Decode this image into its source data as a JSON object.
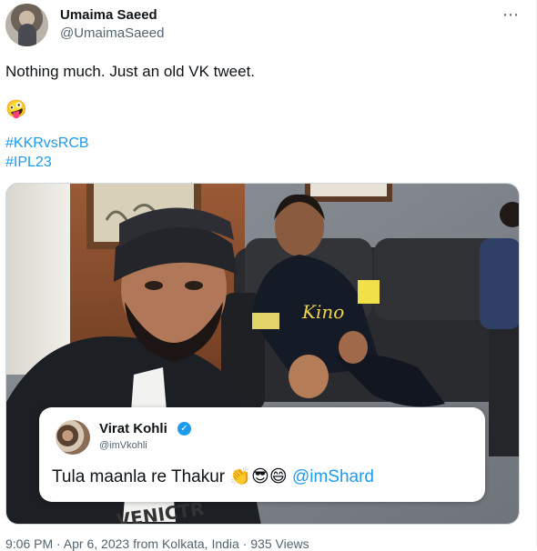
{
  "author": {
    "name": "Umaima Saeed",
    "handle": "@UmaimaSaeed"
  },
  "menu_glyph": "⋯",
  "tweet": {
    "text": "Nothing much. Just an old VK tweet.",
    "emoji": "🤪",
    "hashtags": [
      "#KKRvsRCB",
      "#IPL23"
    ]
  },
  "embedded": {
    "name": "Virat Kohli",
    "handle": "@imVkohli",
    "text": "Tula maanla re Thakur",
    "emojis": "👏😎😄",
    "mention": "@imShard"
  },
  "shirt_text": "VENICTR",
  "jersey_text": "Kino",
  "footer": "9:06 PM · Apr 6, 2023 from Kolkata, India · 935 Views",
  "colors": {
    "link": "#1d9bf0",
    "verified": "#1d9bf0",
    "secondary": "#536471"
  }
}
